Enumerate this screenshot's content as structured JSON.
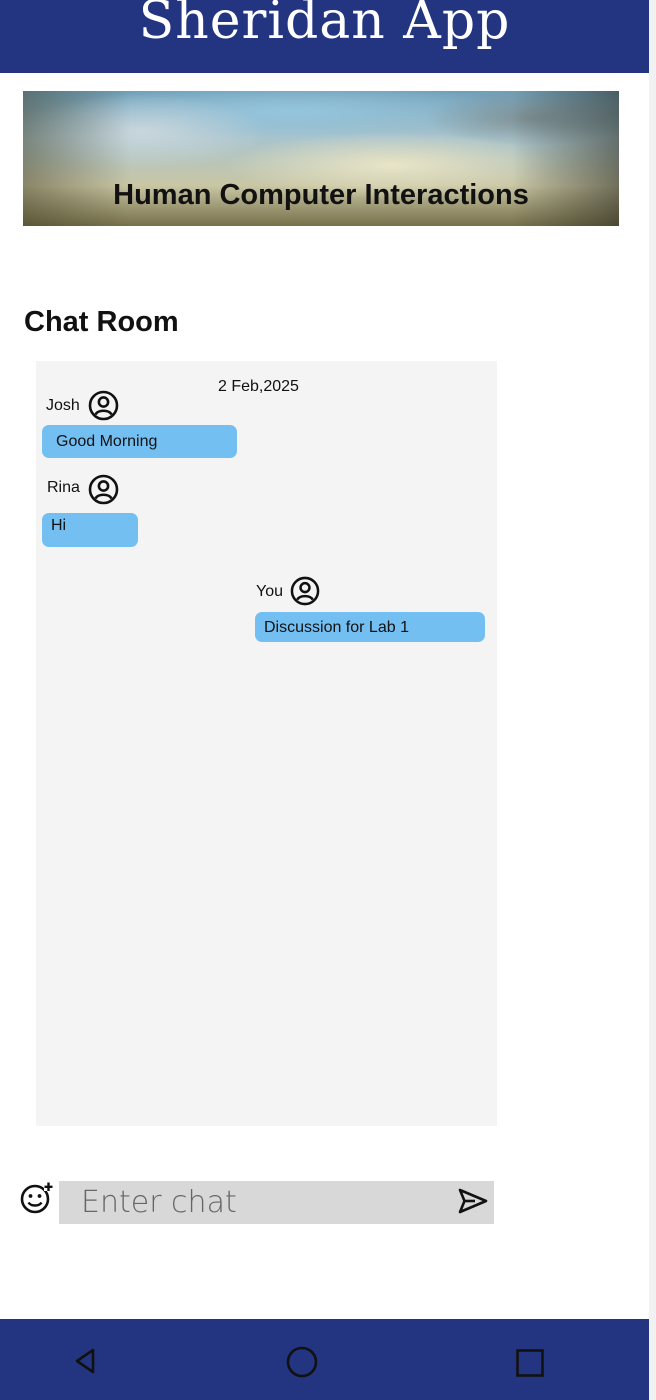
{
  "app": {
    "title": "Sheridan App"
  },
  "banner": {
    "title": "Human Computer Interactions"
  },
  "chat": {
    "section_title": "Chat Room",
    "date": "2 Feb,2025",
    "messages": [
      {
        "sender": "Josh",
        "text": "Good Morning",
        "side": "left"
      },
      {
        "sender": "Rina",
        "text": "Hi",
        "side": "left"
      },
      {
        "sender": "You",
        "text": "Discussion for Lab 1",
        "side": "right"
      }
    ]
  },
  "composer": {
    "placeholder": "Enter chat",
    "emoji_icon": "emoji-add-icon",
    "send_icon": "send-icon"
  },
  "navbar": {
    "back_icon": "back-triangle-icon",
    "home_icon": "home-circle-icon",
    "recents_icon": "recents-square-icon"
  },
  "colors": {
    "primary": "#233580",
    "bubble": "#74bff2",
    "panel": "#f4f4f4",
    "input": "#d8d8d8"
  }
}
